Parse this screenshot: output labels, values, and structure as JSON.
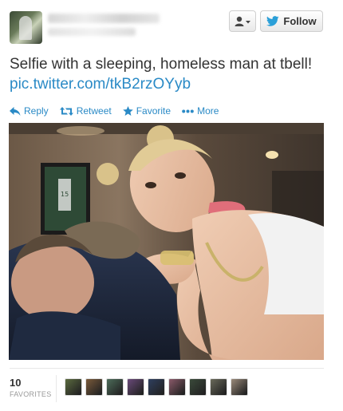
{
  "header": {
    "follow_label": "Follow"
  },
  "tweet": {
    "text": "Selfie with a sleeping, homeless man at tbell! ",
    "link": "pic.twitter.com/tkB2rzOYyb"
  },
  "actions": {
    "reply": "Reply",
    "retweet": "Retweet",
    "favorite": "Favorite",
    "more": "More"
  },
  "stats": {
    "favorites_count": "10",
    "favorites_label": "FAVORITES"
  },
  "favoriter_avatars": [
    {
      "color": "#5b6b3f"
    },
    {
      "color": "#7a5a3a"
    },
    {
      "color": "#4d6d5a"
    },
    {
      "color": "#6a4a7a"
    },
    {
      "color": "#2f3f5f"
    },
    {
      "color": "#8a5a6a"
    },
    {
      "color": "#3a4a3a"
    },
    {
      "color": "#6a6a5a"
    },
    {
      "color": "#9a8a7a"
    }
  ],
  "colors": {
    "link": "#2a8ac6",
    "text": "#333333",
    "muted": "#999999"
  }
}
